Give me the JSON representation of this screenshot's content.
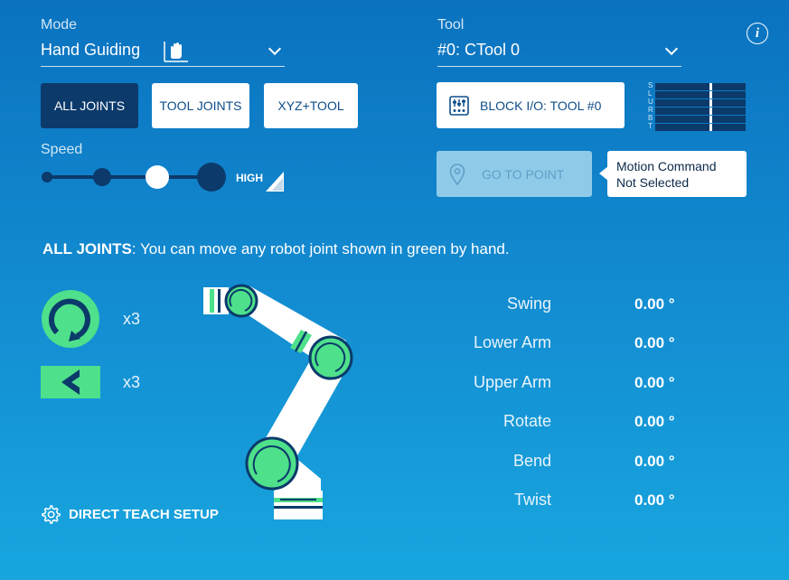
{
  "mode": {
    "label": "Mode",
    "value": "Hand Guiding"
  },
  "tool": {
    "label": "Tool",
    "value": "#0: CTool 0"
  },
  "info_icon": "info-icon",
  "joint_buttons": [
    {
      "label": "ALL JOINTS",
      "active": true
    },
    {
      "label": "TOOL JOINTS",
      "active": false
    },
    {
      "label": "XYZ+TOOL",
      "active": false
    }
  ],
  "block_io": {
    "label": "BLOCK I/O: TOOL #0",
    "icon": "io-panel-icon"
  },
  "axis_letters": [
    "S",
    "L",
    "U",
    "R",
    "B",
    "T"
  ],
  "speed": {
    "label": "Speed",
    "high_label": "HIGH",
    "level": 3,
    "levels": 4
  },
  "go_to_point": {
    "label": "GO TO POINT",
    "icon": "location-pin-icon"
  },
  "tooltip": {
    "line1": "Motion Command",
    "line2": "Not Selected"
  },
  "instruction": {
    "bold": "ALL JOINTS",
    "rest": ": You can move any robot joint shown in green by hand."
  },
  "legend": [
    {
      "icon": "rotary-joint-icon",
      "count": "x3"
    },
    {
      "icon": "linear-joint-icon",
      "count": "x3"
    }
  ],
  "joints": [
    {
      "name": "Swing",
      "value": "0.00 °"
    },
    {
      "name": "Lower Arm",
      "value": "0.00 °"
    },
    {
      "name": "Upper Arm",
      "value": "0.00 °"
    },
    {
      "name": "Rotate",
      "value": "0.00 °"
    },
    {
      "name": "Bend",
      "value": "0.00 °"
    },
    {
      "name": "Twist",
      "value": "0.00 °"
    }
  ],
  "direct_teach": {
    "label": "DIRECT TEACH SETUP",
    "icon": "gear-icon"
  },
  "colors": {
    "green": "#4ee08a",
    "dark_navy": "#0b3a6b"
  }
}
